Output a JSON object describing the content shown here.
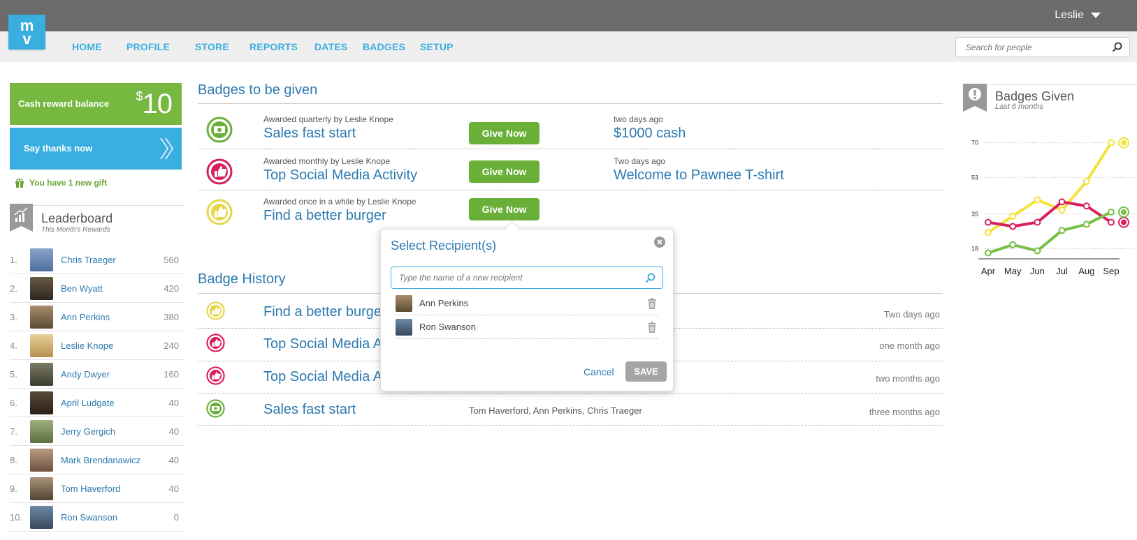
{
  "header": {
    "logo_text": "mv",
    "user_name": "Leslie",
    "nav": [
      "HOME",
      "PROFILE",
      "STORE",
      "REPORTS",
      "DATES",
      "BADGES",
      "SETUP"
    ],
    "search_placeholder": "Search for people"
  },
  "sidebar": {
    "cash_label": "Cash reward balance",
    "cash_currency": "$",
    "cash_amount": "10",
    "thanks_label": "Say thanks now",
    "gift_text": "You have 1 new gift",
    "leaderboard_title": "Leaderboard",
    "leaderboard_subtitle": "This Month's Rewards",
    "leaders": [
      {
        "rank": "1.",
        "name": "Chris Traeger",
        "score": "560"
      },
      {
        "rank": "2.",
        "name": "Ben Wyatt",
        "score": "420"
      },
      {
        "rank": "3.",
        "name": "Ann Perkins",
        "score": "380"
      },
      {
        "rank": "4.",
        "name": "Leslie Knope",
        "score": "240"
      },
      {
        "rank": "5.",
        "name": "Andy Dwyer",
        "score": "160"
      },
      {
        "rank": "6.",
        "name": "April Ludgate",
        "score": "40"
      },
      {
        "rank": "7.",
        "name": "Jerry Gergich",
        "score": "40"
      },
      {
        "rank": "8.",
        "name": "Mark Brendanawicz",
        "score": "40"
      },
      {
        "rank": "9.",
        "name": "Tom Haverford",
        "score": "40"
      },
      {
        "rank": "10.",
        "name": "Ron Swanson",
        "score": "0"
      }
    ]
  },
  "badges_to_give": {
    "title": "Badges to be given",
    "give_label": "Give Now",
    "items": [
      {
        "awarded_by": "Awarded quarterly by Leslie Knope",
        "name": "Sales fast start",
        "when": "two days ago",
        "reward": "$1000 cash",
        "icon": "cash-badge-icon"
      },
      {
        "awarded_by": "Awarded monthly by Leslie Knope",
        "name": "Top Social Media Activity",
        "when": "Two days ago",
        "reward": "Welcome to Pawnee T-shirt",
        "icon": "thumbs-up-badge-icon"
      },
      {
        "awarded_by": "Awarded once in a while by Leslie Knope",
        "name": "Find a better burger",
        "when": "",
        "reward": "",
        "icon": "burger-badge-icon"
      }
    ]
  },
  "badge_history": {
    "title": "Badge History",
    "items": [
      {
        "name": "Find a better burger",
        "who": "",
        "when": "Two days ago"
      },
      {
        "name": "Top Social Media Activity",
        "who": "",
        "when": "one month ago"
      },
      {
        "name": "Top Social Media Activity",
        "who": "",
        "when": "two months ago"
      },
      {
        "name": "Sales fast start",
        "who": "Tom Haverford, Ann Perkins, Chris Traeger",
        "when": "three months ago"
      }
    ]
  },
  "popover": {
    "title": "Select Recipient(s)",
    "input_placeholder": "Type the name of a new recipient",
    "recipients": [
      "Ann Perkins",
      "Ron Swanson"
    ],
    "cancel_label": "Cancel",
    "save_label": "SAVE"
  },
  "badges_given": {
    "title": "Badges Given",
    "subtitle": "Last 6 months"
  },
  "chart_data": {
    "type": "line",
    "categories": [
      "Apr",
      "May",
      "Jun",
      "Jul",
      "Aug",
      "Sep"
    ],
    "y_ticks": [
      18,
      35,
      53,
      70
    ],
    "ylim": [
      10,
      75
    ],
    "grid": true,
    "series": [
      {
        "icon": "burger-badge-icon",
        "color": "#f2e23a",
        "values": [
          26,
          34,
          42,
          37,
          51,
          70
        ]
      },
      {
        "icon": "thumbs-up-badge-icon",
        "color": "#d81e5b",
        "values": [
          31,
          29,
          31,
          41,
          39,
          31
        ]
      },
      {
        "icon": "cash-badge-icon",
        "color": "#76c043",
        "values": [
          16,
          20,
          17,
          27,
          30,
          36
        ]
      }
    ]
  },
  "colors": {
    "brand_blue": "#3aaee0",
    "brand_green": "#77b840",
    "link_blue": "#2c7ab0"
  }
}
